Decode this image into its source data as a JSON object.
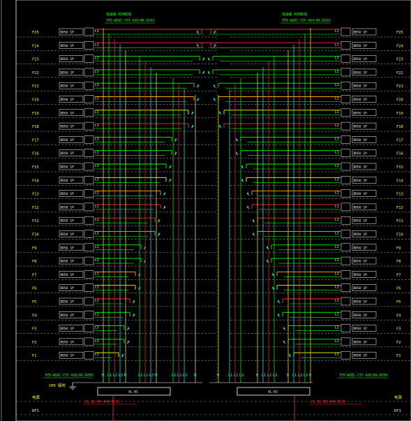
{
  "colors": {
    "background": "#000000",
    "floor_label": "#ffff00",
    "riser_text": "#00ff00",
    "box_text": "#ffffff",
    "phase_L1": "#ff2a2a",
    "phase_L2": "#00ff00",
    "phase_L3": "#ffff00",
    "neutral": "#00ffff",
    "orange": "#ffa500",
    "border": "#ffffff"
  },
  "floors_left": [
    "F25",
    "F24",
    "F23",
    "F22",
    "F21",
    "F20",
    "F19",
    "F18",
    "F17",
    "F16",
    "F15",
    "F14",
    "F13",
    "F12",
    "F11",
    "F10",
    "F9",
    "F8",
    "F7",
    "F6",
    "F5",
    "F4",
    "F3",
    "F2",
    "F1"
  ],
  "floors_right": [
    "F25",
    "F24",
    "F23",
    "F22",
    "F21",
    "F20",
    "F19",
    "F18",
    "F17",
    "F16",
    "F15",
    "F14",
    "F13",
    "F12",
    "F11",
    "F10",
    "F9",
    "F8",
    "F7",
    "F6",
    "F5",
    "F4",
    "F3",
    "F2",
    "F1"
  ],
  "top_left": {
    "line1": "电表箱 照明配电",
    "line2": "YFD-WDZC-YJY-4X4/WX-DX35"
  },
  "top_right": {
    "line1": "电表箱 照明配电",
    "line2": "YFD-WDZC-YJY-4X4/WX-DX35"
  },
  "bottom_left_riser": "YFD-WDZC-YJY-4X6/WX-DX50",
  "bottom_right_riser": "YFD-WDZC-YJY-4X6/WX-DX50",
  "bus_labels_left": [
    "N",
    "L1",
    "L2",
    "L3",
    "N",
    "L1",
    "L2",
    "L3",
    "N",
    "L1",
    "L2",
    "L3",
    "N"
  ],
  "bus_labels_right": [
    "N",
    "L3",
    "L2",
    "L1",
    "N",
    "L3",
    "L2",
    "L1",
    "N",
    "L3",
    "L2",
    "L1",
    "N"
  ],
  "panel_left": "AL-01",
  "panel_right": "AL-02",
  "grounding_note": "SPD 接地",
  "feeder_left": "FL-01   BV-4X4-PC25",
  "feeder_right": "FL-02   BV-4X4-PC25",
  "bottom_label_left_1": "电源",
  "bottom_label_left_2": "DF1",
  "bottom_label_right_1": "电源",
  "bottom_label_right_2": "DF1",
  "meter_box_text": "DDSU 1P",
  "row_label": "L1"
}
